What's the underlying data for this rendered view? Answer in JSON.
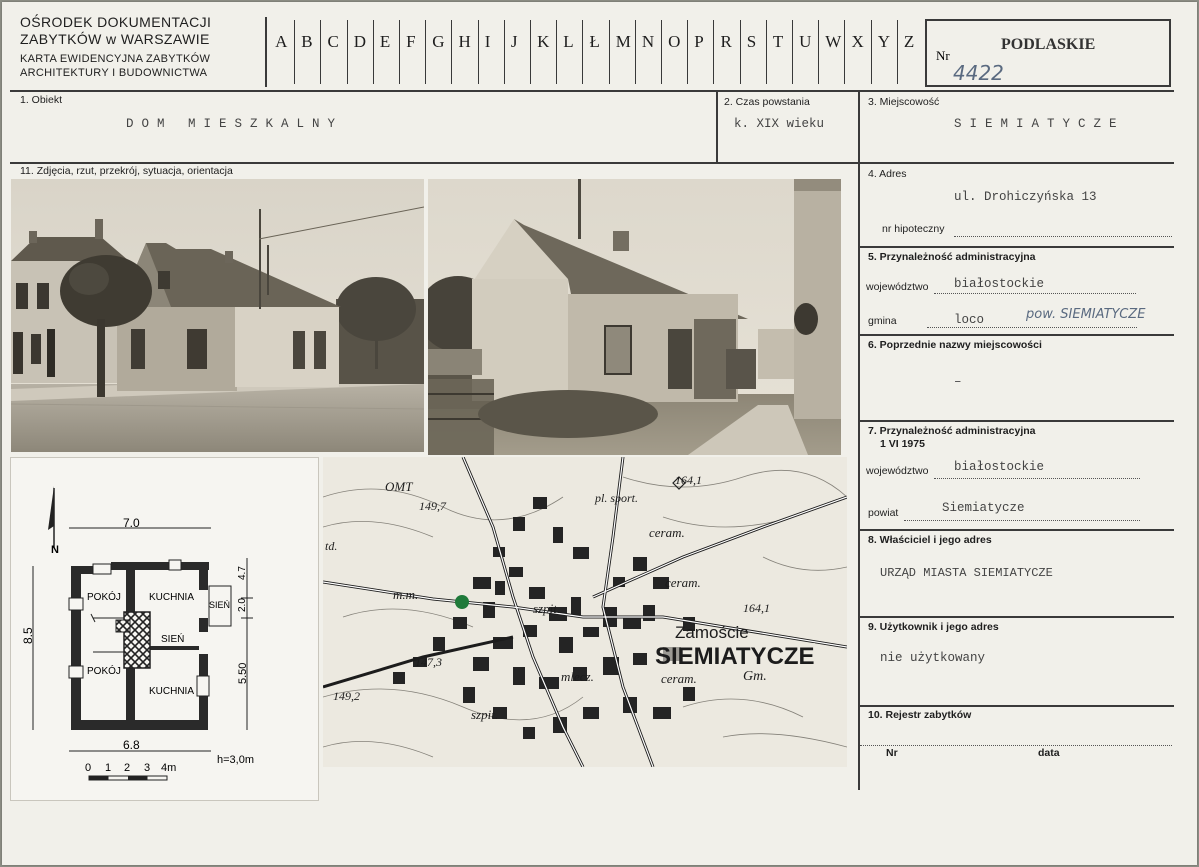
{
  "header": {
    "org_line1": "OŚRODEK DOKUMENTACJI",
    "org_line2": "ZABYTKÓW w WARSZAWIE",
    "org_line3": "KARTA EWIDENCYJNA ZABYTKÓW",
    "org_line4": "ARCHITEKTURY I BUDOWNICTWA",
    "alphabet": [
      "A",
      "B",
      "C",
      "D",
      "E",
      "F",
      "G",
      "H",
      "I",
      "J",
      "K",
      "L",
      "Ł",
      "M",
      "N",
      "O",
      "P",
      "R",
      "S",
      "T",
      "U",
      "W",
      "X",
      "Y",
      "Z"
    ],
    "nr_label": "Nr",
    "nr_value": "4422",
    "region": "PODLASKIE"
  },
  "fields": {
    "f1_label": "1. Obiekt",
    "f1_value": "DOM MIESZKALNY",
    "f2_label": "2. Czas powstania",
    "f2_value": "k. XIX wieku",
    "f3_label": "3. Miejscowość",
    "f3_value": "SIEMIATYCZE",
    "f11_label": "11. Zdjęcia, rzut, przekrój, sytuacja, orientacja",
    "f4_label": "4. Adres",
    "f4_value": "ul. Drohiczyńska 13",
    "f4_hip_label": "nr hipoteczny",
    "f5_label": "5. Przynależność administracyjna",
    "f5_woj_label": "województwo",
    "f5_woj_value": "białostockie",
    "f5_gmina_label": "gmina",
    "f5_gmina_value": "loco",
    "f5_gmina_hand": "pow. SIEMIATYCZE",
    "f6_label": "6. Poprzednie nazwy miejscowości",
    "f6_value": "–",
    "f7_label": "7. Przynależność administracyjna",
    "f7_date": "1 VI 1975",
    "f7_woj_label": "województwo",
    "f7_woj_value": "białostockie",
    "f7_pow_label": "powiat",
    "f7_pow_value": "Siemiatycze",
    "f8_label": "8. Właściciel i jego adres",
    "f8_value": "URZĄD MIASTA SIEMIATYCZE",
    "f9_label": "9. Użytkownik i jego adres",
    "f9_value": "nie użytkowany",
    "f10_label": "10. Rejestr zabytków",
    "f10_nr_label": "Nr",
    "f10_data_label": "data"
  },
  "plan": {
    "dim_top": "7.0",
    "dim_left": "8.5",
    "dim_right_top": "4.7",
    "dim_right_mid": "2.0",
    "dim_right_bot": "5.50",
    "dim_bottom": "6.8",
    "height": "h=3,0m",
    "north": "N",
    "scale_ticks": [
      "0",
      "1",
      "2",
      "3",
      "4m"
    ],
    "rooms": {
      "pokoj_top": "POKÓJ",
      "kuchnia_top": "KUCHNIA",
      "sien_small": "SIEŃ",
      "sien_mid": "SIEŃ",
      "pokoj_bot": "POKÓJ",
      "kuchnia_bot": "KUCHNIA"
    }
  },
  "map": {
    "town": "SIEMIATYCZE",
    "district": "Zamoście",
    "labels": {
      "omt": "OMT",
      "h1497": "149,7",
      "spot": "pl. sport.",
      "h1641a": "164,1",
      "ceram1": "ceram.",
      "mm": "m.m.",
      "szpit1": "szpit.",
      "ceram2": "ceram.",
      "h1641b": "164,1",
      "h1473": "147,3",
      "h1492": "149,2",
      "mlecz": "mlecz.",
      "ceram3": "ceram.",
      "gm": "Gm.",
      "szpit2": "szpit.",
      "td": "td."
    }
  }
}
